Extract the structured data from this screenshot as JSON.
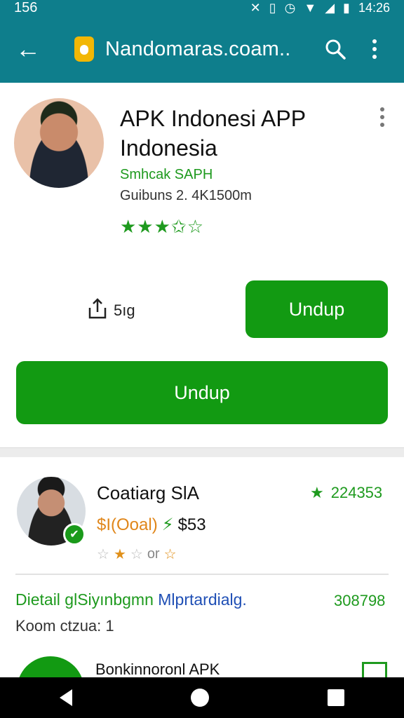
{
  "status_bar": {
    "time_left": "156",
    "time_right": "14:26"
  },
  "toolbar": {
    "url": "Nandomaras.coam..",
    "back_icon": "back-arrow-icon",
    "search_icon": "search-icon",
    "menu_icon": "more-vert-icon"
  },
  "app": {
    "title": "APK Indonesi APP Indonesia",
    "developer": "Smhcak SAPH",
    "sub_info": "Guibuns 2. 4K1500m",
    "rating_stars": "★★★✩☆"
  },
  "actions": {
    "share_count": "5ıg",
    "install_small": "Undup",
    "install_big": "Undup"
  },
  "related": {
    "title": "Coatiarg SlA",
    "score_star": "★",
    "score": "224353",
    "price_label": "$I(Ooal)",
    "price_bolt": "⚡",
    "price_value": "$53",
    "rating_stars_1": "☆",
    "rating_stars_2": "★",
    "rating_stars_3": "☆",
    "rating_text": "or",
    "rating_star_end": "☆",
    "detail_green": "Dietail glSiyınbgmn ",
    "detail_blue": "Mlprtardialg.",
    "detail_num": "308798",
    "koom": "Koom ctzua:  1",
    "next_title": "Bonkinnoronl APK"
  }
}
